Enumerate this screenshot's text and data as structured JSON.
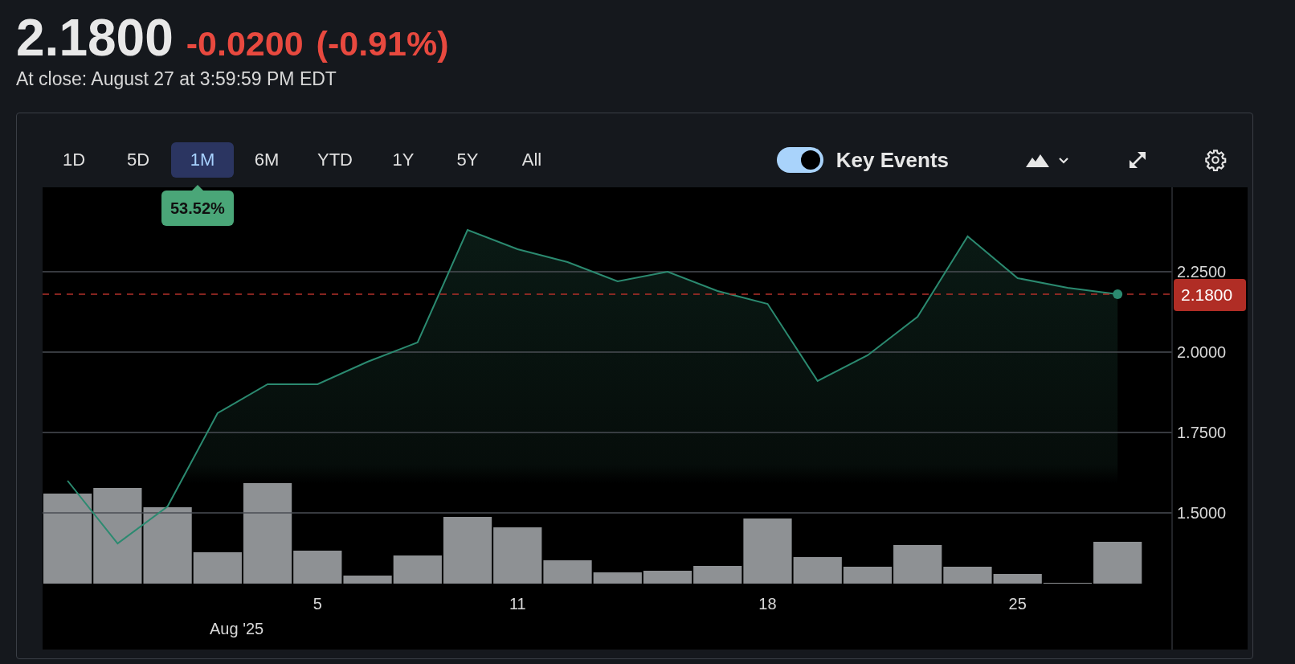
{
  "quote": {
    "price": "2.1800",
    "change": "-0.0200",
    "change_percent": "(-0.91%)",
    "timestamp": "At close: August 27 at 3:59:59 PM EDT"
  },
  "chart_toolbar": {
    "ranges": [
      {
        "label": "1D",
        "selected": false
      },
      {
        "label": "5D",
        "selected": false
      },
      {
        "label": "1M",
        "selected": true
      },
      {
        "label": "6M",
        "selected": false
      },
      {
        "label": "YTD",
        "selected": false
      },
      {
        "label": "1Y",
        "selected": false
      },
      {
        "label": "5Y",
        "selected": false
      },
      {
        "label": "All",
        "selected": false
      }
    ],
    "range_return": "53.52%",
    "key_events": {
      "label": "Key Events",
      "on": true
    }
  },
  "chart": {
    "month_label": "Aug '25",
    "chart_data": {
      "type": "area",
      "categories": [
        null,
        null,
        null,
        null,
        null,
        "5",
        null,
        null,
        null,
        "11",
        null,
        null,
        null,
        null,
        "18",
        null,
        null,
        null,
        null,
        "25",
        null,
        null
      ],
      "series": [
        {
          "color": "#2b8a70",
          "values": [
            1.6,
            1.405,
            1.52,
            1.81,
            1.9,
            1.9,
            1.97,
            2.03,
            2.38,
            2.32,
            2.28,
            2.22,
            2.25,
            2.19,
            2.15,
            1.91,
            1.99,
            2.11,
            2.36,
            2.23,
            2.2,
            2.18
          ]
        }
      ],
      "ylim": [
        1.075,
        2.5125
      ],
      "grid": true,
      "ref_lines": [
        {
          "axis": "y",
          "value": 2.18,
          "label": "2.1800",
          "color": "#b3302a"
        }
      ],
      "yticks": [
        {
          "value": 1.5,
          "label": "1.5000"
        },
        {
          "value": 1.75,
          "label": "1.7500"
        },
        {
          "value": 2.0,
          "label": "2.0000"
        },
        {
          "value": 2.25,
          "label": "2.2500"
        }
      ]
    }
  }
}
